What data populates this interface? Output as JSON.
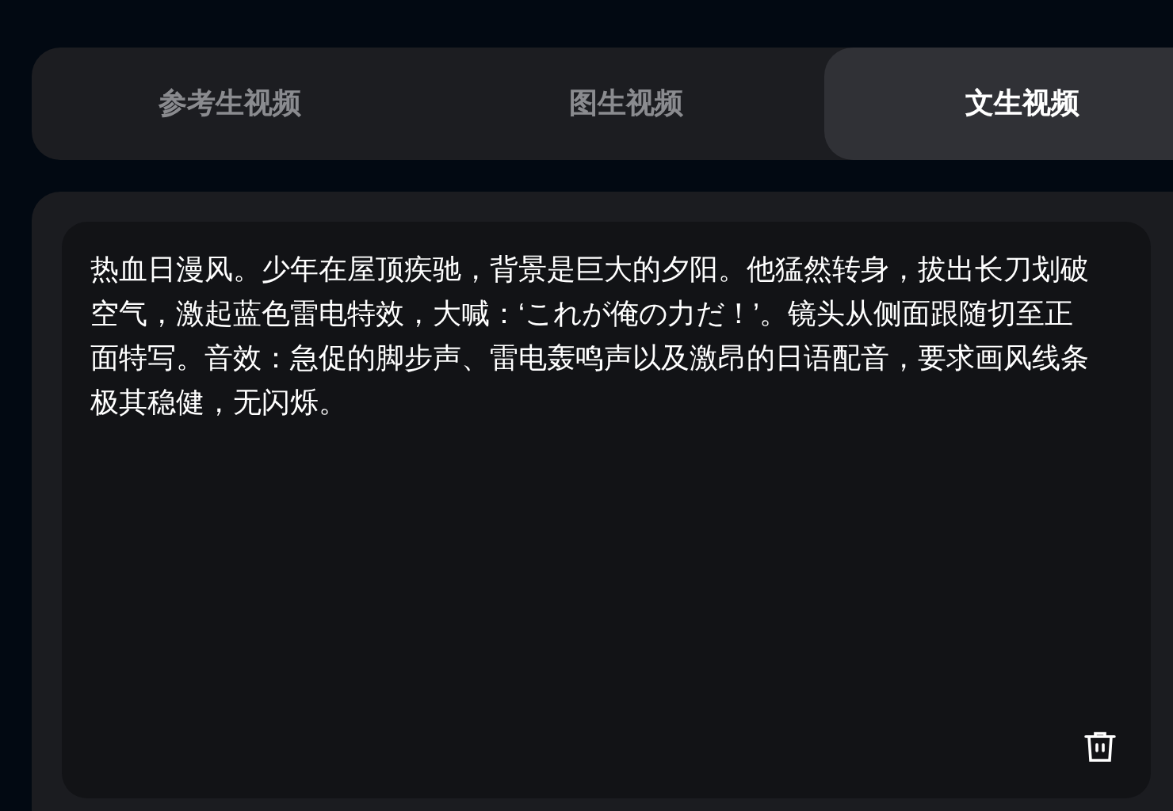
{
  "tabs": [
    {
      "label": "参考生视频",
      "selected": false
    },
    {
      "label": "图生视频",
      "selected": false
    },
    {
      "label": "文生视频",
      "selected": true
    }
  ],
  "prompt": {
    "value": "热血日漫风。少年在屋顶疾驰，背景是巨大的夕阳。他猛然转身，拔出长刀划破空气，激起蓝色雷电特效，大喊：‘これが俺の力だ！’。镜头从侧面跟随切至正面特写。音效：急促的脚步声、雷电轰鸣声以及激昂的日语配音，要求画风线条极其稳健，无闪烁。"
  }
}
